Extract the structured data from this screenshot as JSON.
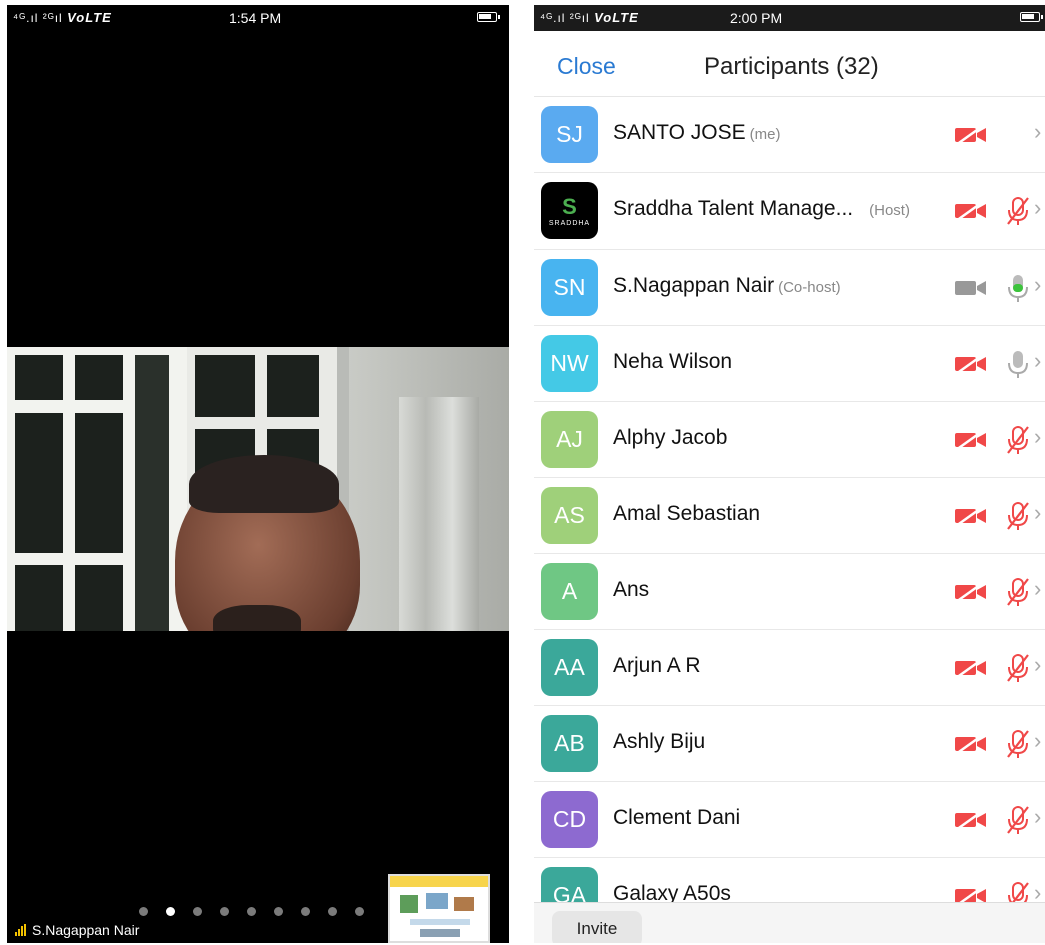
{
  "left_phone": {
    "status": {
      "signal": "⁴ᴳ.ıl ²ᴳıl",
      "network": "VoLTE",
      "time": "1:54 PM"
    },
    "speaker_name": "S.Nagappan Nair",
    "page_dots": {
      "count": 9,
      "active_index": 1
    }
  },
  "right_phone": {
    "status": {
      "signal": "⁴ᴳ.ıl ²ᴳıl",
      "network": "VoLTE",
      "time": "2:00 PM"
    },
    "header": {
      "close_label": "Close",
      "title": "Participants (32)"
    },
    "participants": [
      {
        "initials": "SJ",
        "name": "SANTO JOSE",
        "tag": "(me)",
        "avatar_color": "#5aaaf0",
        "video": "off",
        "audio": "none"
      },
      {
        "initials": "S",
        "name": "Sraddha Talent Manage...",
        "tag": "(Host)",
        "avatar_color": "#000000",
        "logo_text": "SRADDHA",
        "video": "off",
        "audio": "muted"
      },
      {
        "initials": "SN",
        "name": "S.Nagappan Nair",
        "tag": "(Co-host)",
        "avatar_color": "#48b4f0",
        "video": "on",
        "audio": "speaking"
      },
      {
        "initials": "NW",
        "name": "Neha Wilson",
        "tag": "",
        "avatar_color": "#44c9e6",
        "video": "off",
        "audio": "unmuted"
      },
      {
        "initials": "AJ",
        "name": "Alphy Jacob",
        "tag": "",
        "avatar_color": "#9fd07a",
        "video": "off",
        "audio": "muted"
      },
      {
        "initials": "AS",
        "name": "Amal Sebastian",
        "tag": "",
        "avatar_color": "#9fd07a",
        "video": "off",
        "audio": "muted"
      },
      {
        "initials": "A",
        "name": "Ans",
        "tag": "",
        "avatar_color": "#6fc784",
        "video": "off",
        "audio": "muted"
      },
      {
        "initials": "AA",
        "name": "Arjun A R",
        "tag": "",
        "avatar_color": "#3ba89a",
        "video": "off",
        "audio": "muted"
      },
      {
        "initials": "AB",
        "name": "Ashly Biju",
        "tag": "",
        "avatar_color": "#3ba89a",
        "video": "off",
        "audio": "muted"
      },
      {
        "initials": "CD",
        "name": "Clement Dani",
        "tag": "",
        "avatar_color": "#8d6ad0",
        "video": "off",
        "audio": "muted"
      },
      {
        "initials": "GA",
        "name": "Galaxy A50s",
        "tag": "",
        "avatar_color": "#3ba89a",
        "video": "off",
        "audio": "muted"
      }
    ],
    "invite_label": "Invite"
  },
  "colors": {
    "accent_blue": "#2a7ad2",
    "muted_red": "#f04848",
    "speaking_green": "#3cc33c"
  }
}
